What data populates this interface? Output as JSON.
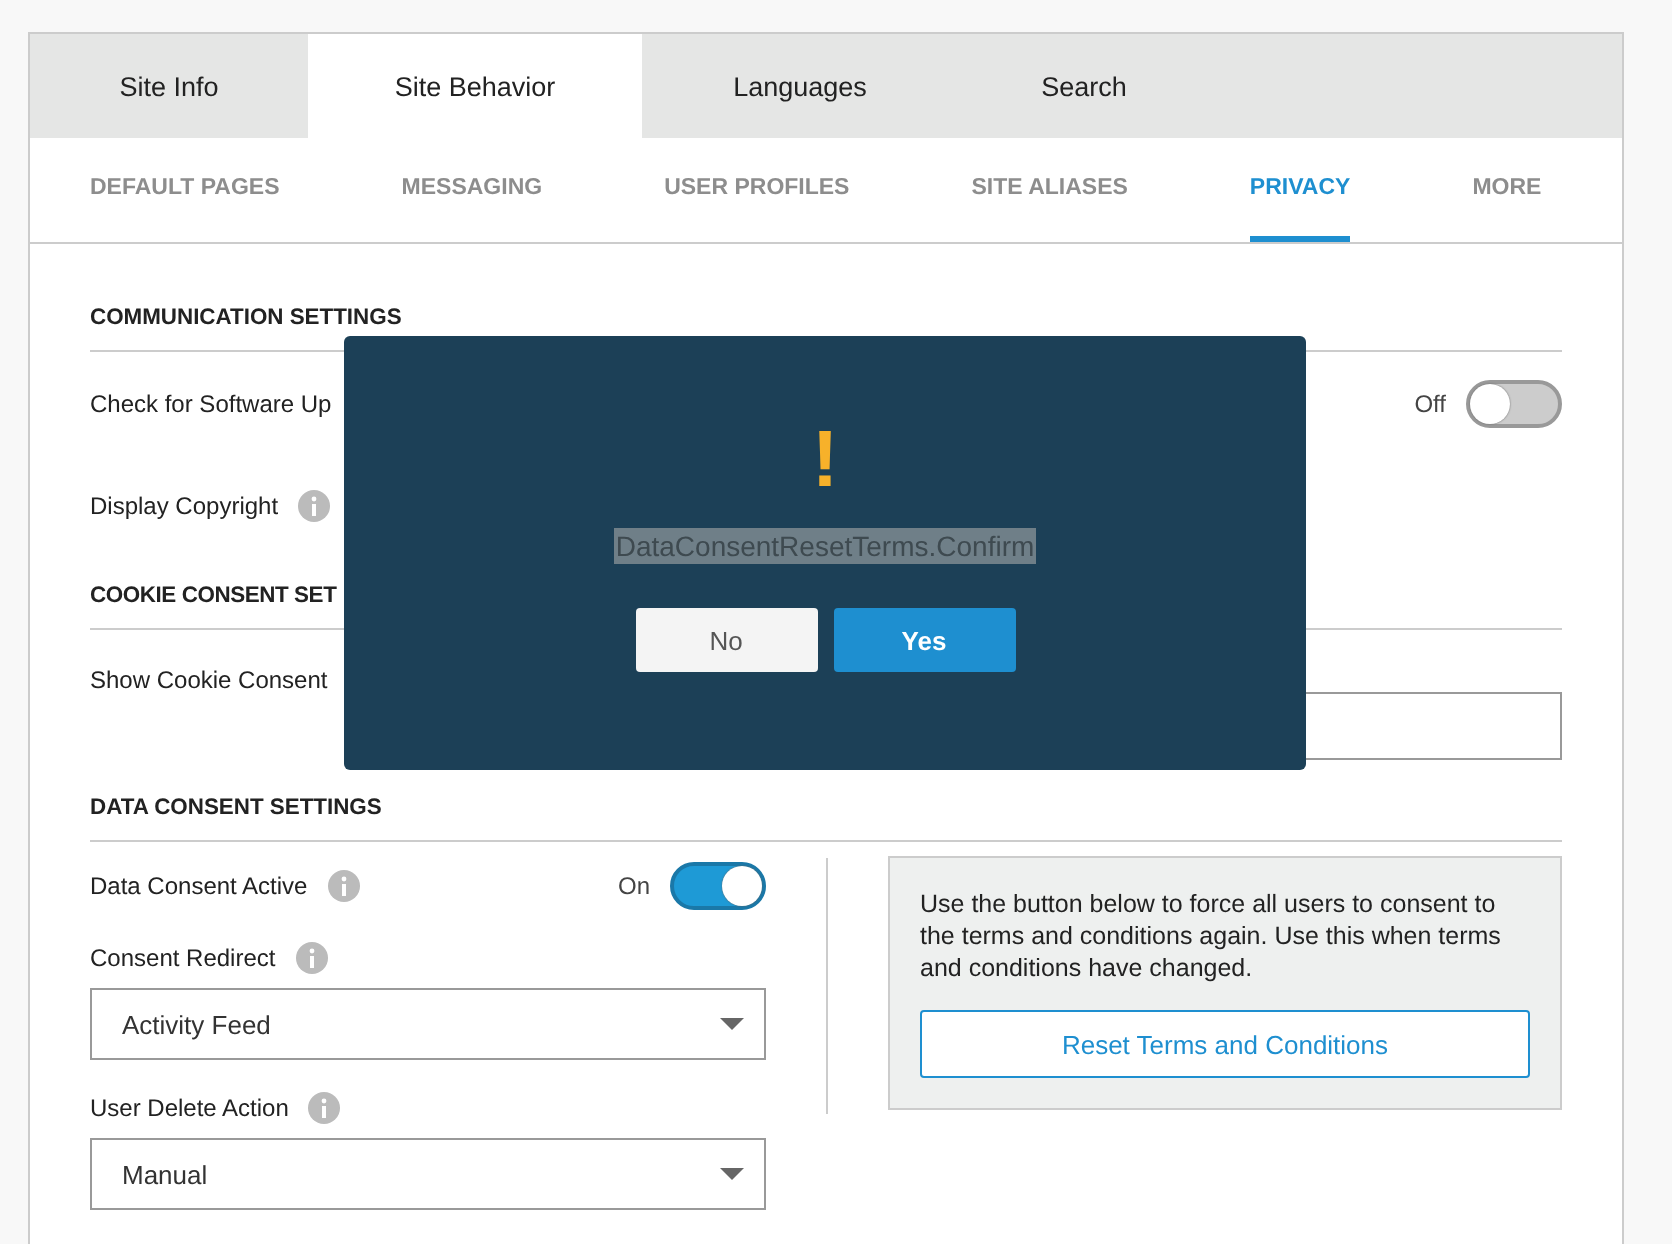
{
  "tabs": [
    {
      "label": "Site Info",
      "selected": false
    },
    {
      "label": "Site Behavior",
      "selected": true
    },
    {
      "label": "Languages",
      "selected": false
    },
    {
      "label": "Search",
      "selected": false
    }
  ],
  "subtabs": [
    {
      "label": "DEFAULT PAGES",
      "selected": false
    },
    {
      "label": "MESSAGING",
      "selected": false
    },
    {
      "label": "USER PROFILES",
      "selected": false
    },
    {
      "label": "SITE ALIASES",
      "selected": false
    },
    {
      "label": "PRIVACY",
      "selected": true
    },
    {
      "label": "MORE",
      "selected": false
    }
  ],
  "communication": {
    "title": "COMMUNICATION SETTINGS",
    "left": [
      {
        "label": "Check for Software Up"
      },
      {
        "label": "Display Copyright"
      }
    ],
    "right": [
      {
        "state_label": "Off",
        "on": false
      }
    ]
  },
  "cookie": {
    "title": "COOKIE CONSENT SET",
    "show": {
      "label": "Show Cookie Consent"
    }
  },
  "data_consent": {
    "title": "DATA CONSENT SETTINGS",
    "active": {
      "label": "Data Consent Active",
      "state_label": "On",
      "on": true
    },
    "redirect": {
      "label": "Consent Redirect",
      "value": "Activity Feed"
    },
    "delete_action": {
      "label": "User Delete Action",
      "value": "Manual"
    },
    "note": "Use the button below to force all users to consent to the terms and conditions again. Use this when terms and conditions have changed.",
    "reset_button": "Reset Terms and Conditions"
  },
  "dialog": {
    "icon": "!",
    "message": "DataConsentResetTerms.Confirm",
    "buttons": [
      {
        "label": "No",
        "kind": "secondary"
      },
      {
        "label": "Yes",
        "kind": "primary"
      }
    ]
  }
}
